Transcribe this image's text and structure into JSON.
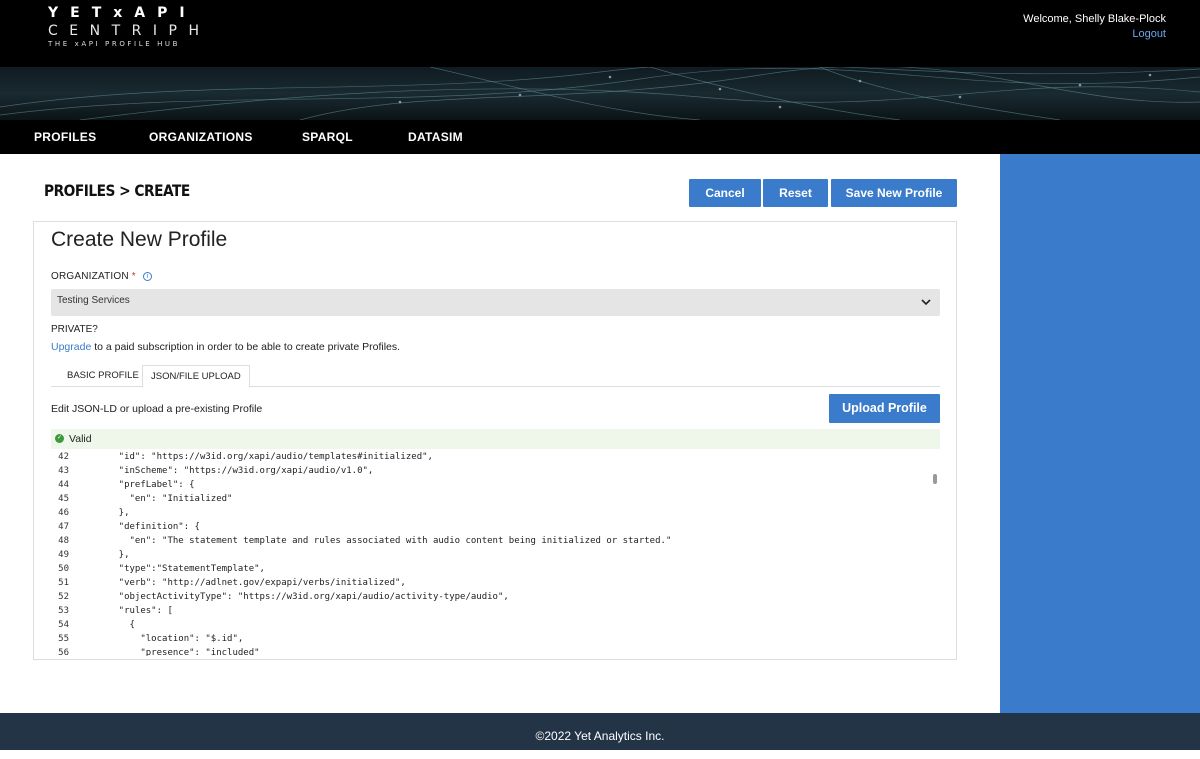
{
  "header": {
    "logo_line1": "YETxAPI",
    "logo_line2": "CENTRIPH",
    "logo_line3": "THE xAPI PROFILE HUB",
    "welcome": "Welcome, Shelly Blake-Plock",
    "logout": "Logout"
  },
  "nav": {
    "items": [
      {
        "label": "PROFILES"
      },
      {
        "label": "ORGANIZATIONS"
      },
      {
        "label": "SPARQL"
      },
      {
        "label": "DATASIM"
      }
    ]
  },
  "page": {
    "breadcrumb": "PROFILES > CREATE",
    "buttons": {
      "cancel": "Cancel",
      "reset": "Reset",
      "save": "Save New Profile"
    }
  },
  "form": {
    "title": "Create New Profile",
    "org_label": "ORGANIZATION",
    "required_mark": "*",
    "org_value": "Testing Services",
    "private_label": "PRIVATE?",
    "upgrade_link": "Upgrade",
    "upgrade_text": " to a paid subscription in order to be able to create private Profiles.",
    "tabs": [
      {
        "label": "BASIC PROFILE",
        "active": false
      },
      {
        "label": "JSON/FILE UPLOAD",
        "active": true
      }
    ],
    "edit_text": "Edit JSON-LD or upload a pre-existing Profile",
    "upload_button": "Upload Profile",
    "valid_text": "Valid",
    "code_lines": [
      {
        "n": "42",
        "text": "    \"id\": \"https://w3id.org/xapi/audio/templates#initialized\","
      },
      {
        "n": "43",
        "text": "    \"inScheme\": \"https://w3id.org/xapi/audio/v1.0\","
      },
      {
        "n": "44",
        "text": "    \"prefLabel\": {"
      },
      {
        "n": "45",
        "text": "      \"en\": \"Initialized\""
      },
      {
        "n": "46",
        "text": "    },"
      },
      {
        "n": "47",
        "text": "    \"definition\": {"
      },
      {
        "n": "48",
        "text": "      \"en\": \"The statement template and rules associated with audio content being initialized or started.\""
      },
      {
        "n": "49",
        "text": "    },"
      },
      {
        "n": "50",
        "text": "    \"type\":\"StatementTemplate\","
      },
      {
        "n": "51",
        "text": "    \"verb\": \"http://adlnet.gov/expapi/verbs/initialized\","
      },
      {
        "n": "52",
        "text": "    \"objectActivityType\": \"https://w3id.org/xapi/audio/activity-type/audio\","
      },
      {
        "n": "53",
        "text": "    \"rules\": ["
      },
      {
        "n": "54",
        "text": "      {"
      },
      {
        "n": "55",
        "text": "        \"location\": \"$.id\","
      },
      {
        "n": "56",
        "text": "        \"presence\": \"included\""
      }
    ]
  },
  "footer": {
    "text": "©2022 Yet Analytics Inc."
  },
  "colors": {
    "accent": "#3a7ccb",
    "topbar": "#000000",
    "footer": "#243447",
    "valid_bg": "#eef7ea"
  }
}
